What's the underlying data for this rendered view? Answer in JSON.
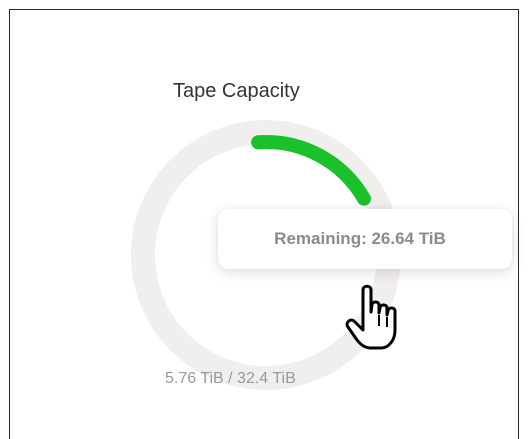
{
  "widget": {
    "title": "Tape Capacity",
    "caption": "5.76 TiB / 32.4 TiB",
    "used_tib": 5.76,
    "total_tib": 32.4,
    "used_fraction": 0.178,
    "track_color": "#f1eeee",
    "fill_color": "#1ac12c"
  },
  "tooltip": {
    "text": "Remaining: 26.64 TiB"
  },
  "cursor": {
    "icon": "hand-pointer-icon"
  }
}
